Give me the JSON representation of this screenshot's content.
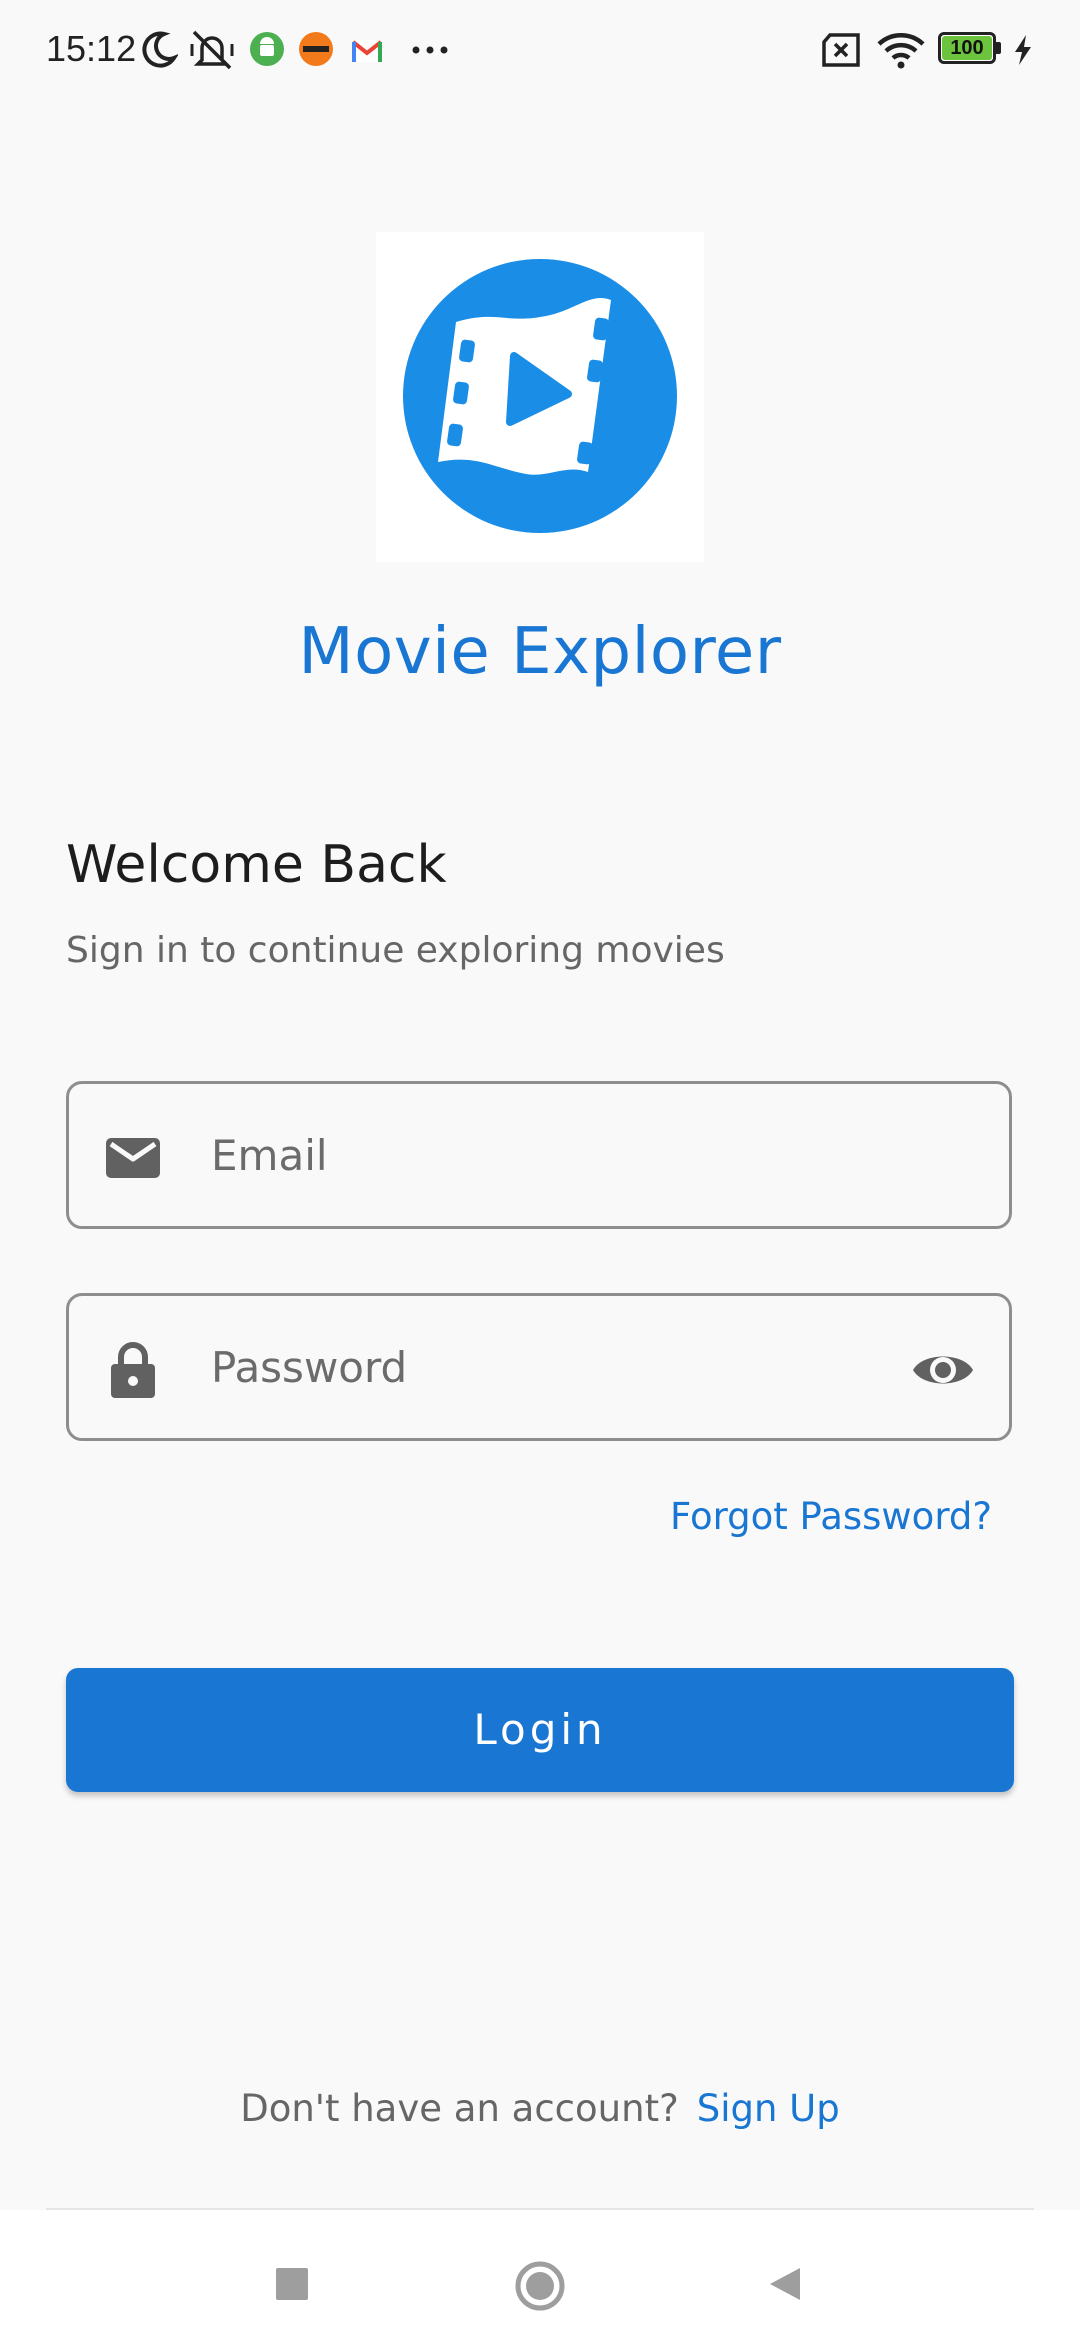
{
  "status_bar": {
    "time": "15:12",
    "battery": "100",
    "icons": [
      "moon-icon",
      "vibrate-off-icon",
      "android-icon",
      "trendyol-icon",
      "gmail-icon",
      "more-dots-icon",
      "sim-x-icon",
      "wifi-icon",
      "battery-icon",
      "charging-icon"
    ]
  },
  "app": {
    "title": "Movie Explorer",
    "logo_icon": "film-play-icon",
    "brand_color": "#1976d2"
  },
  "login": {
    "heading": "Welcome Back",
    "subtitle": "Sign in to continue exploring movies",
    "email_placeholder": "Email",
    "password_placeholder": "Password",
    "forgot_label": "Forgot Password?",
    "button_label": "Login",
    "signup_prompt": "Don't have an account?",
    "signup_label": "Sign Up"
  },
  "nav": {
    "icons": [
      "recents-square-icon",
      "home-circle-icon",
      "back-triangle-icon"
    ]
  }
}
